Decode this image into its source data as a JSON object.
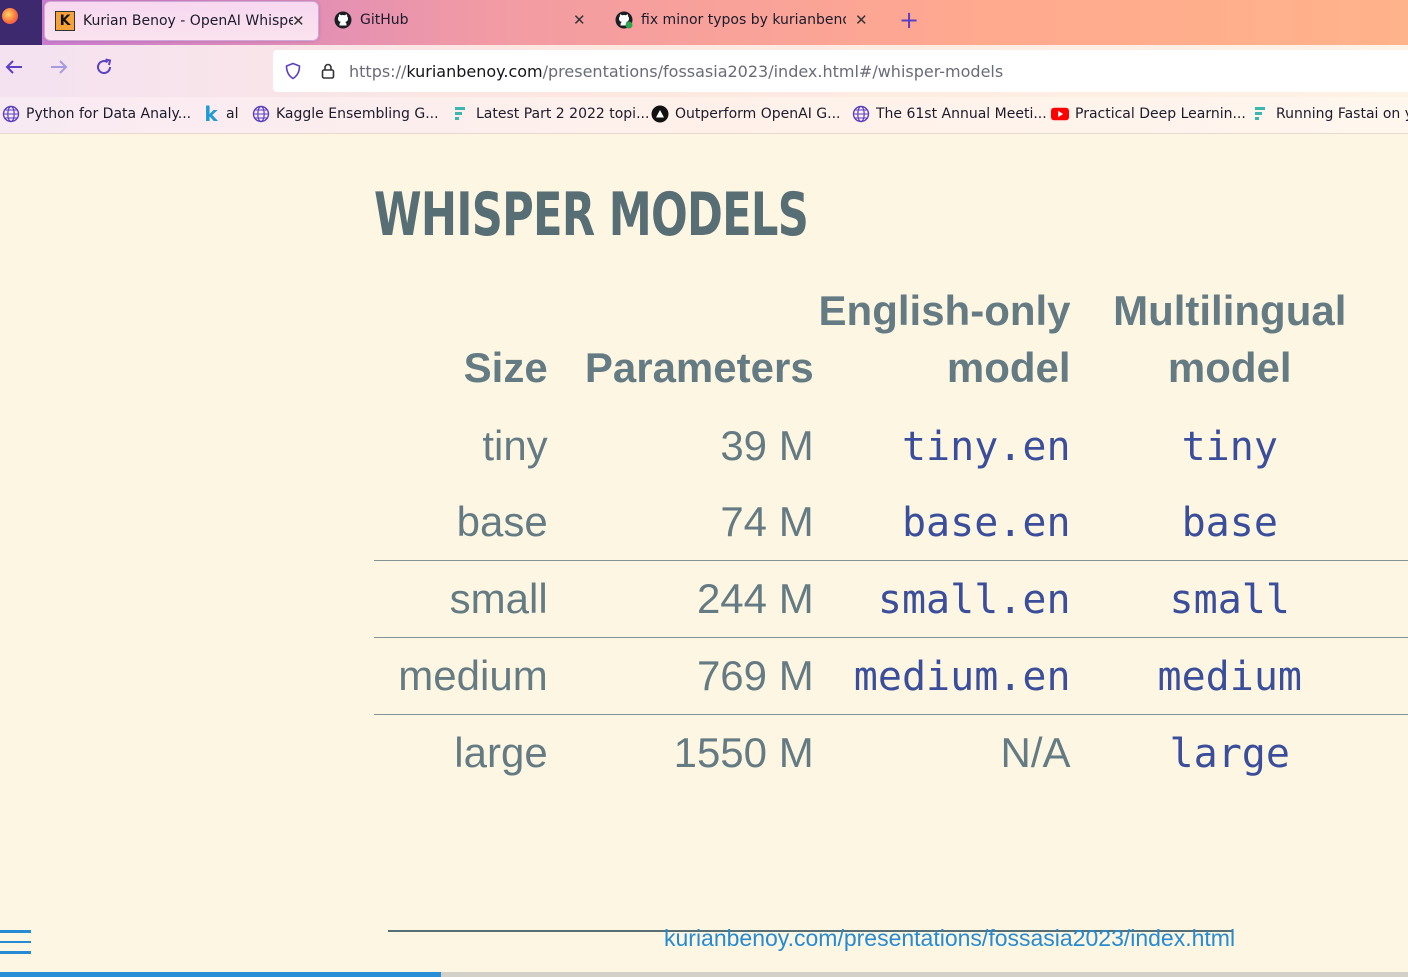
{
  "browser": {
    "tabs": [
      {
        "title": "Kurian Benoy - OpenAI Whisper",
        "favicon": "K",
        "active": true
      },
      {
        "title": "GitHub",
        "favicon": "github-icon",
        "active": false
      },
      {
        "title": "fix minor typos by kurianbenoy",
        "favicon": "github-icon",
        "active": false
      }
    ],
    "new_tab_label": "+",
    "url": {
      "prefix": "https://",
      "host": "kurianbenoy.com",
      "path": "/presentations/fossasia2023/index.html#/whisper-models"
    },
    "bookmarks": [
      {
        "label": "Python for Data Analy...",
        "icon": "globe-icon"
      },
      {
        "label": "al",
        "icon": "k-logo-icon"
      },
      {
        "label": "Kaggle Ensembling G...",
        "icon": "globe-icon"
      },
      {
        "label": "Latest Part 2 2022 topi...",
        "icon": "fastai-icon"
      },
      {
        "label": "Outperform OpenAI G...",
        "icon": "black-circle-icon"
      },
      {
        "label": "The 61st Annual Meeti...",
        "icon": "globe-icon"
      },
      {
        "label": "Practical Deep Learnin...",
        "icon": "youtube-icon"
      },
      {
        "label": "Running Fastai on yo",
        "icon": "fastai-icon"
      }
    ]
  },
  "slide": {
    "title": "WHISPER MODELS",
    "table": {
      "headers": [
        "Size",
        "Parameters",
        "English-only model",
        "Multilingual model"
      ],
      "rows": [
        {
          "size": "tiny",
          "params": "39 M",
          "english": "tiny.en",
          "multi": "tiny"
        },
        {
          "size": "base",
          "params": "74 M",
          "english": "base.en",
          "multi": "base"
        },
        {
          "size": "small",
          "params": "244 M",
          "english": "small.en",
          "multi": "small"
        },
        {
          "size": "medium",
          "params": "769 M",
          "english": "medium.en",
          "multi": "medium"
        },
        {
          "size": "large",
          "params": "1550 M",
          "english": "N/A",
          "multi": "large"
        }
      ]
    },
    "footer_link": "kurianbenoy.com/presentations/fossasia2023/index.html",
    "progress": 0.313
  },
  "colors": {
    "background": "#fdf6e3",
    "heading": "#586e75",
    "text": "#657b83",
    "code": "#3b4e9b",
    "link": "#268bd2"
  }
}
